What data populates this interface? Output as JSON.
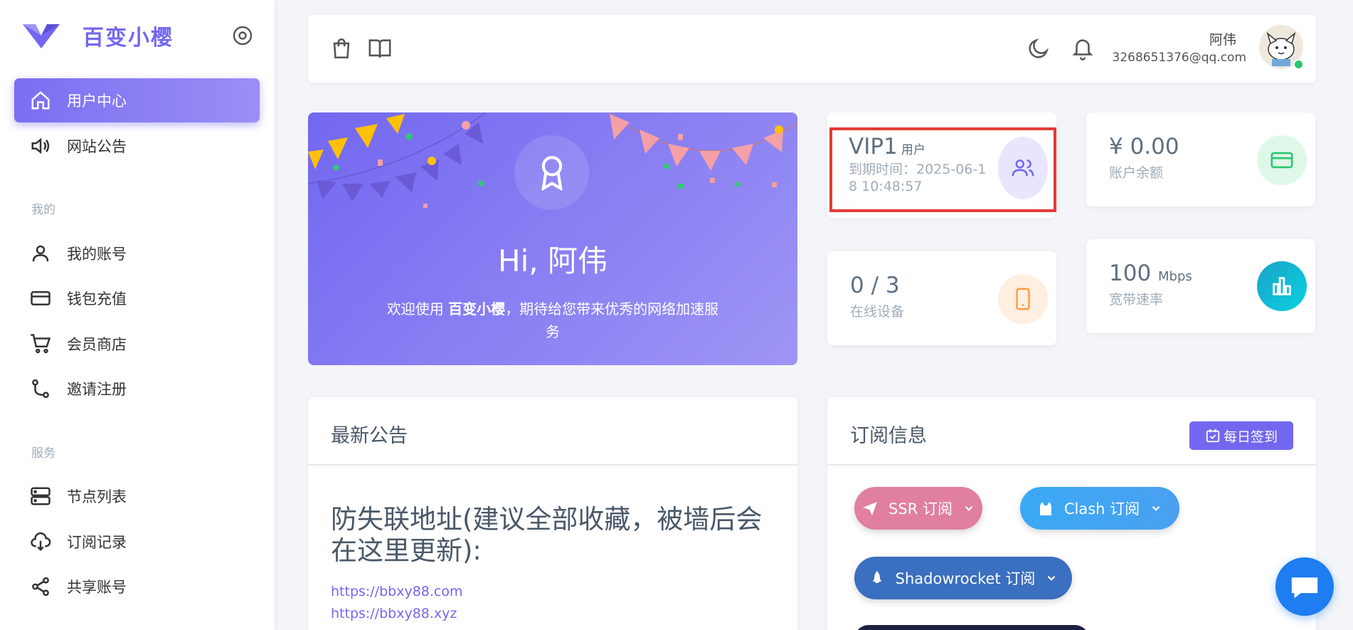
{
  "brand": {
    "name": "百变小樱"
  },
  "sidebar": {
    "active_item": "用户中心",
    "items": [
      {
        "label": "用户中心",
        "icon": "home-icon"
      },
      {
        "label": "网站公告",
        "icon": "megaphone-icon"
      }
    ],
    "sections": [
      {
        "header": "我的",
        "items": [
          {
            "label": "我的账号",
            "icon": "user-icon"
          },
          {
            "label": "钱包充值",
            "icon": "credit-card-icon"
          },
          {
            "label": "会员商店",
            "icon": "cart-icon"
          },
          {
            "label": "邀请注册",
            "icon": "git-branch-icon"
          }
        ]
      },
      {
        "header": "服务",
        "items": [
          {
            "label": "节点列表",
            "icon": "server-icon"
          },
          {
            "label": "订阅记录",
            "icon": "cloud-download-icon"
          },
          {
            "label": "共享账号",
            "icon": "share-icon"
          }
        ]
      }
    ]
  },
  "topbar": {
    "user_name": "阿伟",
    "user_email": "3268651376@qq.com",
    "status_color": "#28c76f"
  },
  "welcome": {
    "greeting": "Hi, 阿伟",
    "message_prefix": "欢迎使用 ",
    "message_brand": "百变小樱",
    "message_suffix": "，期待给您带来优秀的网络加速服务"
  },
  "stats": {
    "vip": {
      "level": "VIP1",
      "suffix": "用户",
      "expiry": "到期时间：2025-06-18 10:48:57"
    },
    "balance": {
      "value": "¥ 0.00",
      "label": "账户余额"
    },
    "devices": {
      "value": "0 / 3",
      "label": "在线设备"
    },
    "bandwidth": {
      "value": "100",
      "unit": "Mbps",
      "label": "宽带速率"
    }
  },
  "announcement": {
    "title": "最新公告",
    "heading": "防失联地址(建议全部收藏，被墙后会在这里更新):",
    "links": [
      "https://bbxy88.com",
      "https://bbxy88.xyz"
    ]
  },
  "subscription": {
    "title": "订阅信息",
    "checkin_label": "每日签到",
    "buttons": [
      {
        "label": "SSR 订阅",
        "color": "#e07fa0"
      },
      {
        "label": "Clash 订阅",
        "color": "#3aa9f5"
      },
      {
        "label": "Shadowrocket 订阅",
        "color": "#3b6fbf"
      }
    ]
  },
  "colors": {
    "primary": "#7367f0",
    "danger": "#e53935"
  }
}
